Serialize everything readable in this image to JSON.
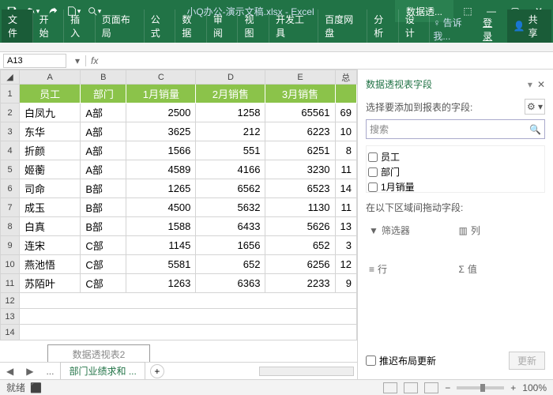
{
  "titlebar": {
    "doc_title": "小Q办公-演示文稿.xlsx - Excel",
    "context_tab": "数据透..."
  },
  "ribbon": {
    "file": "文件",
    "tabs": [
      "开始",
      "插入",
      "页面布局",
      "公式",
      "数据",
      "审阅",
      "视图",
      "开发工具",
      "百度网盘",
      "分析",
      "设计"
    ],
    "tellme": "♀ 告诉我...",
    "login": "登录",
    "share": "共享"
  },
  "formula": {
    "namebox": "A13",
    "fx": "fx"
  },
  "grid": {
    "cols": [
      "A",
      "B",
      "C",
      "D",
      "E"
    ],
    "last_col": "总",
    "header": [
      "员工",
      "部门",
      "1月销量",
      "2月销售",
      "3月销售"
    ],
    "rows": [
      [
        "白凤九",
        "A部",
        "2500",
        "1258",
        "65561",
        "69"
      ],
      [
        "东华",
        "A部",
        "3625",
        "212",
        "6223",
        "10"
      ],
      [
        "折颜",
        "A部",
        "1566",
        "551",
        "6251",
        "8"
      ],
      [
        "姬蘅",
        "A部",
        "4589",
        "4166",
        "3230",
        "11"
      ],
      [
        "司命",
        "B部",
        "1265",
        "6562",
        "6523",
        "14"
      ],
      [
        "成玉",
        "B部",
        "4500",
        "5632",
        "1130",
        "11"
      ],
      [
        "白真",
        "B部",
        "1588",
        "6433",
        "5626",
        "13"
      ],
      [
        "连宋",
        "C部",
        "1145",
        "1656",
        "652",
        "3"
      ],
      [
        "燕池悟",
        "C部",
        "5581",
        "652",
        "6256",
        "12"
      ],
      [
        "苏陌叶",
        "C部",
        "1263",
        "6363",
        "2233",
        "9"
      ]
    ],
    "pivot_placeholder": "数据透视表2"
  },
  "tabs": {
    "active": "部门业绩求和",
    "add": "+",
    "ellipsis": "..."
  },
  "pane": {
    "title": "数据透视表字段",
    "subtitle": "选择要添加到报表的字段:",
    "search": "搜索",
    "fields": [
      "员工",
      "部门",
      "1月销量"
    ],
    "areas_label": "在以下区域间拖动字段:",
    "filter": "筛选器",
    "columns": "列",
    "rows": "行",
    "values": "值",
    "defer": "推迟布局更新",
    "update": "更新"
  },
  "status": {
    "ready": "就绪",
    "rec": "⬛",
    "zoom": "100%"
  }
}
